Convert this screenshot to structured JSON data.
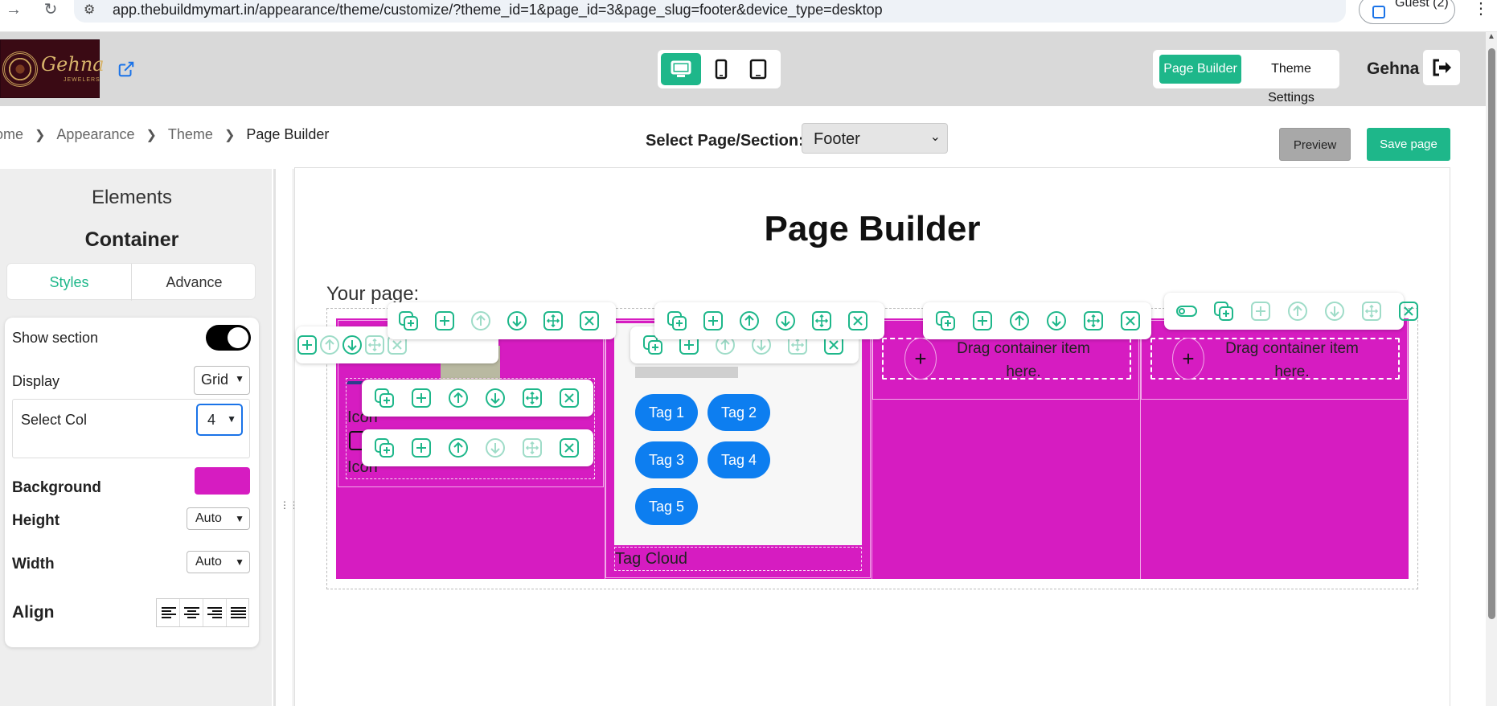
{
  "browser": {
    "url": "app.thebuildmymart.in/appearance/theme/customize/?theme_id=1&page_id=3&page_slug=footer&device_type=desktop",
    "profile": "Guest (2)"
  },
  "header": {
    "logo_text": "Gehna",
    "logo_sub": "JEWELERS",
    "tabs": [
      "Page Builder",
      "Theme Settings"
    ],
    "active_tab": "Page Builder",
    "user": "Gehna"
  },
  "breadcrumb": [
    "ome",
    "Appearance",
    "Theme",
    "Page Builder"
  ],
  "page_select": {
    "label": "Select Page/Section:",
    "value": "Footer"
  },
  "actions": {
    "preview": "Preview",
    "save": "Save page"
  },
  "panel": {
    "elements_title": "Elements",
    "container_title": "Container",
    "tabs": [
      "Styles",
      "Advance"
    ],
    "show_section": "Show section",
    "display_label": "Display",
    "display_value": "Grid",
    "select_col_label": "Select Col",
    "select_col_value": "4",
    "background_label": "Background",
    "background_color": "#d61cc1",
    "height_label": "Height",
    "height_value": "Auto",
    "width_label": "Width",
    "width_value": "Auto",
    "align_label": "Align"
  },
  "canvas": {
    "title": "Page Builder",
    "your_page": "Your page:",
    "icon_label": "Icon",
    "tags": [
      "Tag 1",
      "Tag 2",
      "Tag 3",
      "Tag 4",
      "Tag 5"
    ],
    "tag_cloud": "Tag Cloud",
    "drop_text": "Drag container item here."
  },
  "colors": {
    "accent": "#1eb78a",
    "tag": "#0d7ef0",
    "magenta": "#d61cc1"
  }
}
